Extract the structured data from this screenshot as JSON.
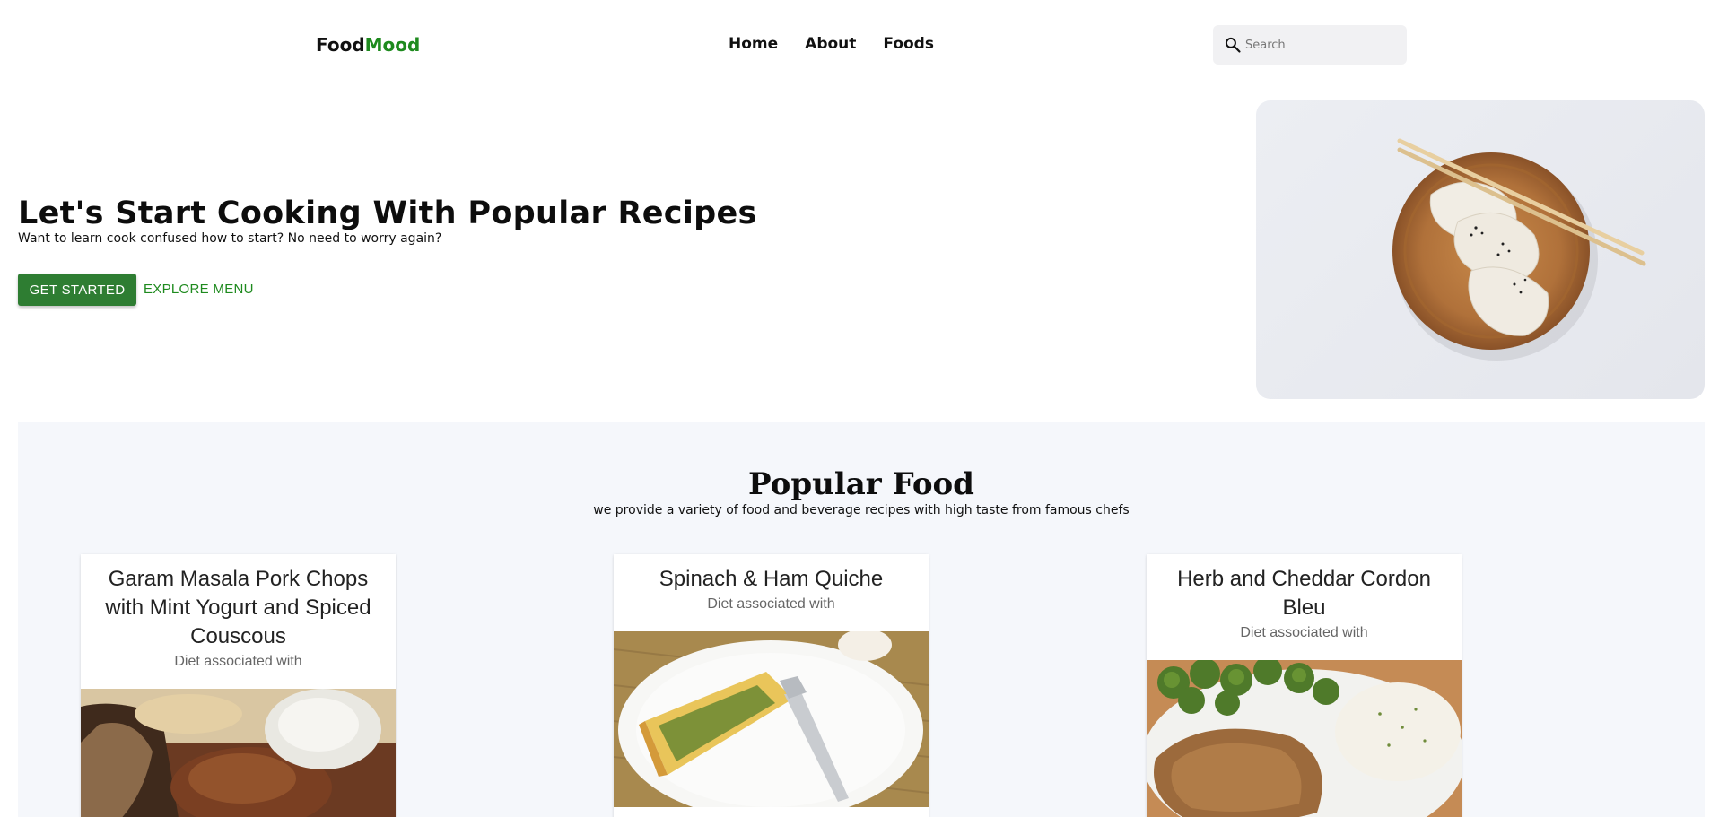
{
  "logo": {
    "part1": "Food",
    "part2": "Mood"
  },
  "nav": {
    "items": [
      "Home",
      "About",
      "Foods"
    ]
  },
  "search": {
    "placeholder": "Search"
  },
  "hero": {
    "title": "Let's Start Cooking With Popular Recipes",
    "subtitle": "Want to learn cook confused how to start? No need to worry again?",
    "primary_button": "GET STARTED",
    "secondary_button": "EXPLORE MENU"
  },
  "popular": {
    "title": "Popular Food",
    "subtitle": "we provide a variety of food and beverage recipes with high taste from famous chefs",
    "cards": [
      {
        "title": "Garam Masala Pork Chops with Mint Yogurt and Spiced Couscous",
        "subtitle": "Diet associated with"
      },
      {
        "title": "Spinach & Ham Quiche",
        "subtitle": "Diet associated with"
      },
      {
        "title": "Herb and Cheddar Cordon Bleu",
        "subtitle": "Diet associated with"
      }
    ]
  },
  "colors": {
    "accent_green": "#1e8a1e",
    "button_green": "#2e7d32",
    "section_bg": "#f5f7fb"
  }
}
